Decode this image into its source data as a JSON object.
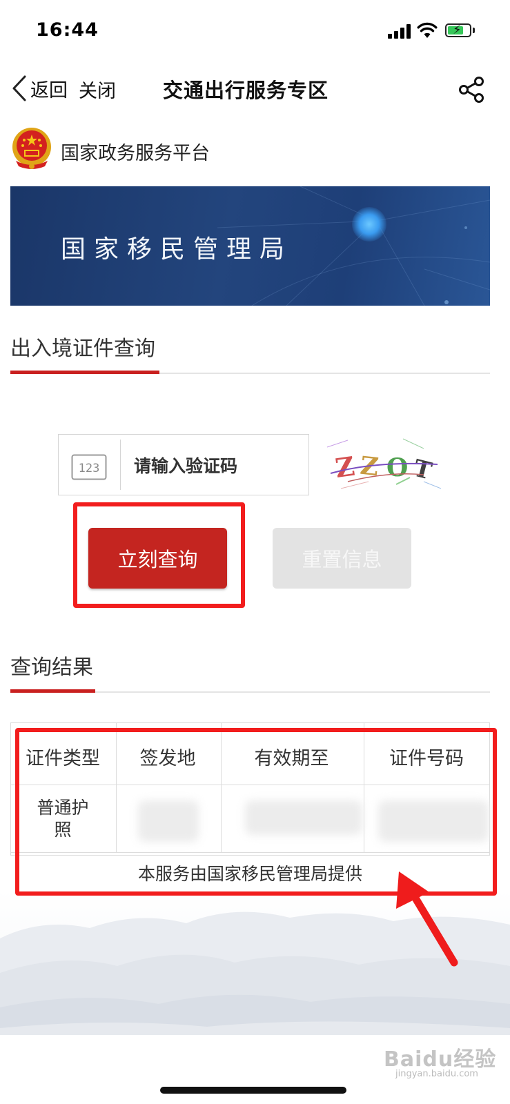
{
  "status_bar": {
    "time": "16:44"
  },
  "nav": {
    "back_label": "返回",
    "close_label": "关闭",
    "title": "交通出行服务专区"
  },
  "platform": {
    "name": "国家政务服务平台"
  },
  "banner": {
    "title": "国家移民管理局"
  },
  "query_section": {
    "title": "出入境证件查询"
  },
  "captcha": {
    "icon_text": "123",
    "placeholder": "请输入验证码",
    "image_text": "ZZOT"
  },
  "buttons": {
    "query": "立刻查询",
    "reset": "重置信息"
  },
  "result_section": {
    "title": "查询结果"
  },
  "table": {
    "headers": [
      "证件类型",
      "签发地",
      "有效期至",
      "证件号码"
    ],
    "rows": [
      {
        "type_line1": "普通护",
        "type_line2": "照"
      }
    ],
    "footer": "本服务由国家移民管理局提供"
  },
  "watermark": {
    "brand": "Baidu经验",
    "url": "jingyan.baidu.com"
  },
  "colors": {
    "accent_red": "#c42520",
    "highlight_red": "#f21d1d",
    "banner_blue": "#1e3f78"
  }
}
